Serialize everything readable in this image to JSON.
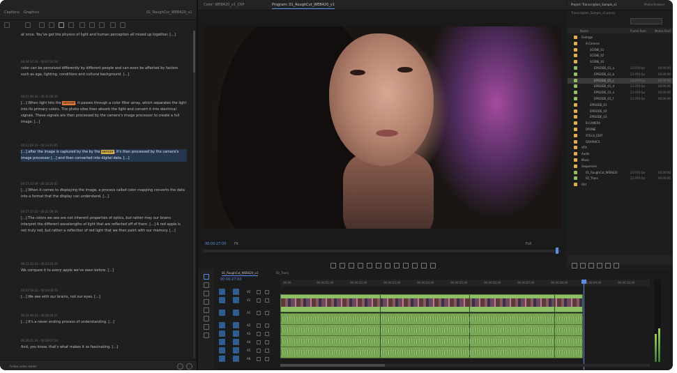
{
  "transcript": {
    "tabs": [
      "Captions",
      "Graphics",
      "01_RoughCut_WEB420_v1"
    ],
    "entries": [
      {
        "meta": "",
        "parts": [
          {
            "t": "at once. You've got the physics of light and human perception all mixed up together. [...]"
          }
        ]
      },
      {
        "meta": "00:04:37:16 - 00:07:53:18",
        "parts": [
          {
            "t": "color can be perceived differently by different people and can even be affected by factors such as age, lighting, conditions and cultural background. [...]"
          }
        ]
      },
      {
        "meta": "00:07:09:16 - 00:11:09:10",
        "parts": [
          {
            "t": "[...] When light hits the "
          },
          {
            "t": "sensor",
            "hl": true
          },
          {
            "t": ", it passes through a color filter array, which separates the light into its primary colors. The photo sites then absorb the light and convert it into electrical signals. These signals are then processed by the camera's image processor to create a full image. [...]"
          }
        ]
      },
      {
        "meta": "00:11:29:10 - 00:13:13:05",
        "sel": true,
        "parts": [
          {
            "t": "[...] after the image is captured by the by the "
          },
          {
            "t": "sensor",
            "hl": true
          },
          {
            "t": ", it's then processed by the camera's image processor [...] and then converted into digital data. [...]"
          }
        ]
      },
      {
        "meta": "00:13:15:09 - 00:16:22:05",
        "parts": [
          {
            "t": "[...] When it comes to displaying the image, a process called color mapping converts the data into a format that the display can understand. [...]"
          }
        ]
      },
      {
        "meta": "00:17:17:10 - 00:21:09:14",
        "parts": [
          {
            "t": "[...] The colors we see are not inherent properties of optics, but rather may our brains interpret the different wavelengths of light that are reflected off of them. [...] A red apple is not truly red, but rather a reflection of red light that we then paint with our memory. [...]"
          }
        ]
      },
      {
        "meta": "00:21:15:10 - 00:23:10:10",
        "parts": [
          {
            "t": "We compare it to every apple we've seen before. [...]"
          }
        ]
      },
      {
        "meta": "00:23:19:12 - 00:24:08:16",
        "parts": [
          {
            "t": "[...] We see with our brains, not our eyes. [...]"
          }
        ]
      },
      {
        "meta": "00:24:09:10 - 00:26:20:15",
        "parts": [
          {
            "t": "[...] It's a never ending process of understanding. [...]"
          }
        ]
      },
      {
        "meta": "00:26:21:16 - 00:28:07:10",
        "parts": [
          {
            "t": "And, you know, that's what makes it so fascinating. [...]"
          }
        ]
      }
    ],
    "footer_label": "Follow video reader"
  },
  "program": {
    "tabs": [
      "Color: WEB420_v1_CRP",
      "Program: 01_RoughCut_WEB420_v1"
    ],
    "timecode": "00:00:27:00",
    "fit": "Fit",
    "quality": "Full",
    "playhead_fraction": 0.985
  },
  "project": {
    "title": "Project: Transcription_Sample_v1",
    "extra": "Media Browser",
    "subtitle": "Transcription_Sample_v1.prproj",
    "columns": [
      "Name",
      "Frame Rate",
      "Media Start"
    ],
    "bins": [
      {
        "name": "Footage",
        "indent": 1,
        "color": "#e0b04a",
        "c1": "",
        "c2": ""
      },
      {
        "name": "A-Camera",
        "indent": 2,
        "color": "#e0b04a",
        "c1": "",
        "c2": ""
      },
      {
        "name": "SCENE_01",
        "indent": 3,
        "color": "#e0b04a",
        "c1": "",
        "c2": ""
      },
      {
        "name": "SCENE_02",
        "indent": 3,
        "color": "#e0b04a",
        "c1": "",
        "c2": ""
      },
      {
        "name": "SCENE_03",
        "indent": 3,
        "color": "#e0b04a",
        "c1": "",
        "c2": ""
      },
      {
        "name": "EPISODE_01_a",
        "indent": 4,
        "color": "#8fbf64",
        "c1": "23.976 fps",
        "c2": "00:00:00"
      },
      {
        "name": "EPISODE_01_b",
        "indent": 4,
        "color": "#8fbf64",
        "c1": "23.976 fps",
        "c2": "00:00:00"
      },
      {
        "name": "EPISODE_01_c",
        "indent": 4,
        "color": "#8fbf64",
        "c1": "23.976 fps",
        "c2": "00:00:00",
        "sel": true
      },
      {
        "name": "EPISODE_01_d",
        "indent": 4,
        "color": "#8fbf64",
        "c1": "23.976 fps",
        "c2": "00:00:00"
      },
      {
        "name": "EPISODE_01_e",
        "indent": 4,
        "color": "#8fbf64",
        "c1": "23.976 fps",
        "c2": "00:00:00"
      },
      {
        "name": "EPISODE_01_f",
        "indent": 4,
        "color": "#8fbf64",
        "c1": "23.976 fps",
        "c2": "00:00:00"
      },
      {
        "name": "EPISODE_01",
        "indent": 3,
        "color": "#e0b04a",
        "c1": "",
        "c2": ""
      },
      {
        "name": "EPISODE_02",
        "indent": 3,
        "color": "#e0b04a",
        "c1": "",
        "c2": ""
      },
      {
        "name": "EPISODE_03",
        "indent": 3,
        "color": "#e0b04a",
        "c1": "",
        "c2": ""
      },
      {
        "name": "B-CAMERA",
        "indent": 2,
        "color": "#e0b04a",
        "c1": "",
        "c2": ""
      },
      {
        "name": "DRONE",
        "indent": 2,
        "color": "#e0b04a",
        "c1": "",
        "c2": ""
      },
      {
        "name": "STILLS_EDIT",
        "indent": 2,
        "color": "#e0b04a",
        "c1": "",
        "c2": ""
      },
      {
        "name": "GRAPHICS",
        "indent": 2,
        "color": "#e0b04a",
        "c1": "",
        "c2": ""
      },
      {
        "name": "VFX",
        "indent": 1,
        "color": "#e0b04a",
        "c1": "",
        "c2": ""
      },
      {
        "name": "Audio",
        "indent": 1,
        "color": "#e0b04a",
        "c1": "",
        "c2": ""
      },
      {
        "name": "Music",
        "indent": 1,
        "color": "#e0b04a",
        "c1": "",
        "c2": ""
      },
      {
        "name": "Sequences",
        "indent": 1,
        "color": "#e0b04a",
        "c1": "",
        "c2": ""
      },
      {
        "name": "01_RoughCut_WEB420",
        "indent": 2,
        "color": "#8fbf64",
        "c1": "23.976 fps",
        "c2": "00:00:00"
      },
      {
        "name": "02_Trans",
        "indent": 2,
        "color": "#8fbf64",
        "c1": "23.976 fps",
        "c2": "00:00:00"
      },
      {
        "name": "Old",
        "indent": 1,
        "color": "#e0b04a",
        "c1": "",
        "c2": ""
      }
    ]
  },
  "timeline": {
    "tabs": [
      "01_RoughCut_WEB420_v1",
      "02_Trans"
    ],
    "timecode": "00:00:27:00",
    "ticks": [
      "00:00",
      "00:00:01:00",
      "00:00:02:00",
      "00:00:03:00",
      "00:00:04:00",
      "00:00:05:00",
      "00:00:06:00",
      "00:00:07:00",
      "00:00:08:00",
      "00:00:09:00",
      "00:00:10:00"
    ],
    "tracks": [
      {
        "name": "V2"
      },
      {
        "name": "V1"
      },
      {
        "name": "A1"
      },
      {
        "name": "A2"
      },
      {
        "name": "A3"
      },
      {
        "name": "A4"
      },
      {
        "name": "A5"
      },
      {
        "name": "A6"
      }
    ]
  },
  "colors": {
    "accent": "#5e8ee0",
    "clip": "#8fbf64",
    "highlight": "#e07a36",
    "selection": "#25374f"
  }
}
